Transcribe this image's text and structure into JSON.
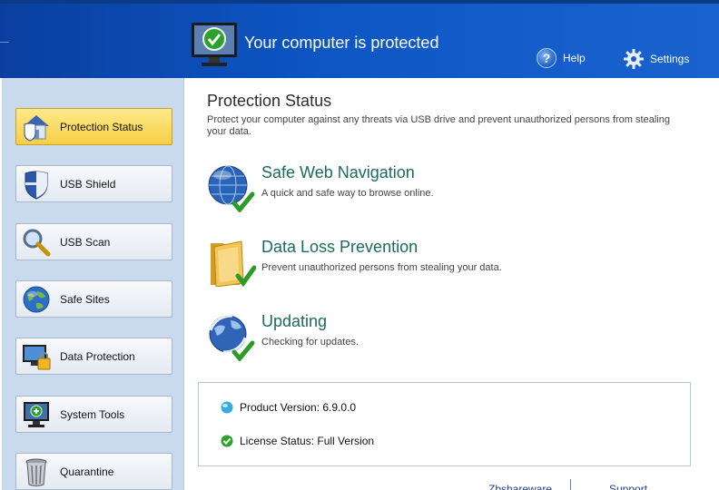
{
  "header": {
    "title": "Your computer is protected",
    "help_label": "Help",
    "settings_label": "Settings"
  },
  "sidebar": {
    "items": [
      {
        "label": "Protection Status",
        "icon": "house-shield-icon",
        "active": true
      },
      {
        "label": "USB Shield",
        "icon": "shield-icon"
      },
      {
        "label": "USB Scan",
        "icon": "magnifier-icon"
      },
      {
        "label": "Safe Sites",
        "icon": "globe-icon"
      },
      {
        "label": "Data Protection",
        "icon": "monitor-lock-icon"
      },
      {
        "label": "System Tools",
        "icon": "monitor-plus-icon"
      },
      {
        "label": "Quarantine",
        "icon": "trash-bin-icon"
      }
    ]
  },
  "main": {
    "title": "Protection Status",
    "description": "Protect your computer against any threats via USB drive and prevent unauthorized persons from stealing your data.",
    "features": [
      {
        "name": "Safe Web Navigation",
        "desc": "A quick and safe way to browse online.",
        "icon": "globe-check-icon"
      },
      {
        "name": "Data Loss Prevention",
        "desc": "Prevent unauthorized persons from stealing your data.",
        "icon": "folder-check-icon"
      },
      {
        "name": "Updating",
        "desc": "Checking for updates.",
        "icon": "globe-sync-check-icon"
      }
    ],
    "info": {
      "product_version": "Product Version: 6.9.0.0",
      "license_status": "License Status: Full Version"
    },
    "footer": {
      "link1": "Zbshareware",
      "link2": "Support"
    }
  },
  "colors": {
    "header_blue": "#0d56c4",
    "sidebar_bg": "#c9d9ee",
    "active_yellow": "#f7cf45",
    "feature_title": "#1b6b5b"
  }
}
